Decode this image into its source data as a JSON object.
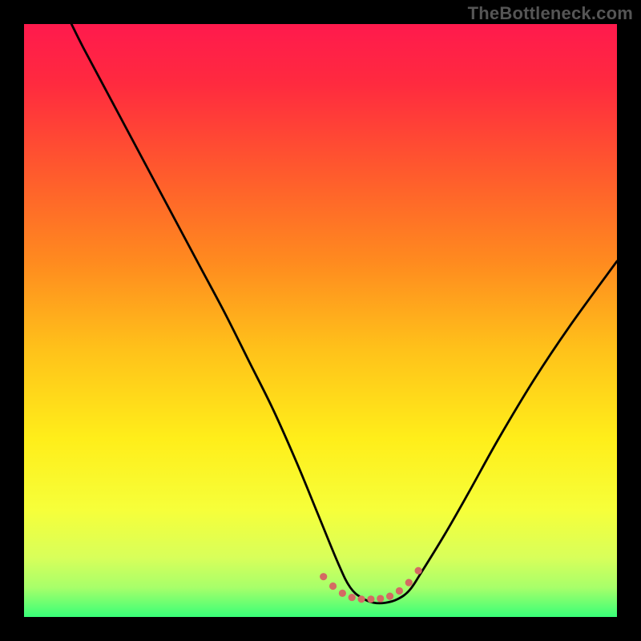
{
  "watermark": "TheBottleneck.com",
  "chart_data": {
    "type": "line",
    "title": "",
    "xlabel": "",
    "ylabel": "",
    "xlim": [
      0,
      100
    ],
    "ylim": [
      0,
      100
    ],
    "background_gradient_stops": [
      {
        "offset": 0.0,
        "color": "#ff1a4d"
      },
      {
        "offset": 0.1,
        "color": "#ff2a3f"
      },
      {
        "offset": 0.25,
        "color": "#ff5a2d"
      },
      {
        "offset": 0.4,
        "color": "#ff8a1f"
      },
      {
        "offset": 0.55,
        "color": "#ffc21a"
      },
      {
        "offset": 0.7,
        "color": "#ffee1a"
      },
      {
        "offset": 0.82,
        "color": "#f6ff3a"
      },
      {
        "offset": 0.9,
        "color": "#d8ff5a"
      },
      {
        "offset": 0.95,
        "color": "#a8ff6a"
      },
      {
        "offset": 1.0,
        "color": "#38ff78"
      }
    ],
    "series": [
      {
        "name": "bottleneck-curve",
        "color": "#000000",
        "stroke_width": 2.8,
        "x": [
          8,
          10,
          14,
          18,
          22,
          26,
          30,
          34,
          38,
          42,
          46,
          49.5,
          53,
          55,
          57,
          59,
          61,
          63,
          65,
          67,
          71,
          75,
          80,
          86,
          92,
          100
        ],
        "y": [
          100,
          96,
          88.5,
          81,
          73.5,
          66,
          58.5,
          51,
          43,
          35,
          26,
          17.5,
          9,
          5,
          3.2,
          2.4,
          2.4,
          3.0,
          4.5,
          7.5,
          14,
          21,
          30,
          40,
          49,
          60
        ]
      },
      {
        "name": "marker-band",
        "type": "dotted-band",
        "color": "#d46a63",
        "dot_radius": 4.6,
        "dot_gap": 11,
        "x_range": [
          50.5,
          66.5
        ],
        "y_level": 3.5,
        "shape_y": [
          6.8,
          5.2,
          4.0,
          3.3,
          3.0,
          3.0,
          3.1,
          3.5,
          4.4,
          5.8,
          7.8
        ]
      }
    ]
  }
}
